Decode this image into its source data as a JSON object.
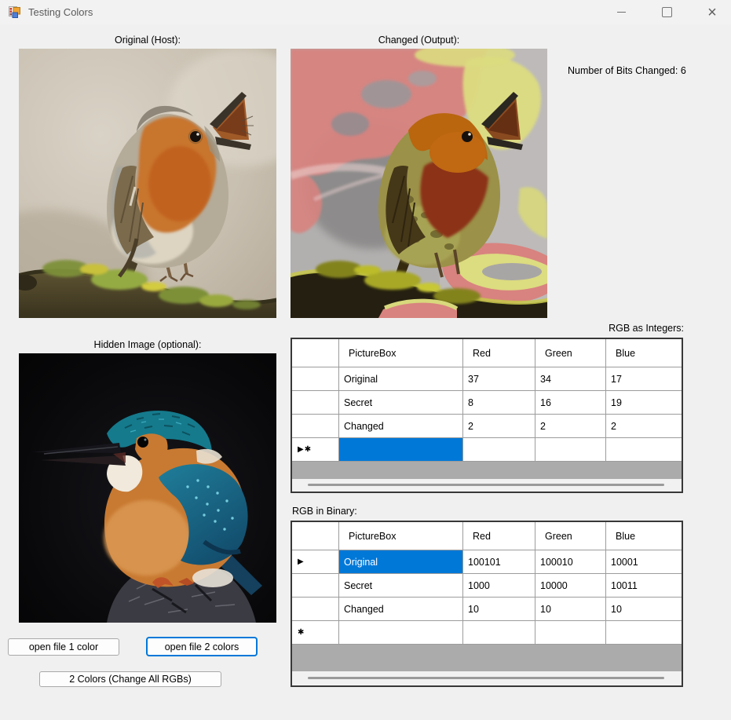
{
  "titlebar": {
    "title": "Testing Colors",
    "controls": {
      "minimize": "",
      "close": "×"
    }
  },
  "labels": {
    "original_caption": "Original (Host):",
    "changed_caption": "Changed (Output):",
    "bits_changed": "Number of Bits Changed: 6",
    "hidden_caption": "Hidden Image (optional):"
  },
  "tables": {
    "integers": {
      "title": "RGB as Integers:",
      "columns": [
        "PictureBox",
        "Red",
        "Green",
        "Blue"
      ],
      "rows": [
        [
          "Original",
          "37",
          "34",
          "17"
        ],
        [
          "Secret",
          "8",
          "16",
          "19"
        ],
        [
          "Changed",
          "2",
          "2",
          "2"
        ]
      ],
      "new_row_marker": "▶✱"
    },
    "binary": {
      "title": "RGB in Binary:",
      "columns": [
        "PictureBox",
        "Red",
        "Green",
        "Blue"
      ],
      "rows": [
        [
          "Original",
          "100101",
          "100010",
          "10001"
        ],
        [
          "Secret",
          "1000",
          "10000",
          "10011"
        ],
        [
          "Changed",
          "10",
          "10",
          "10"
        ]
      ],
      "selected_row_marker": "▶",
      "new_row_marker": "✱"
    }
  },
  "buttons": {
    "open_one": "open file 1 color",
    "open_two": "open file 2 colors",
    "change_all": "2 Colors (Change All RGBs)"
  },
  "colors": {
    "selection_blue": "#0078d8",
    "grid_filler_gray": "#ababab",
    "red_overlay": "#d8837f",
    "yellow_overlay": "#dcdc80",
    "window_bg": "#f0f0f0"
  }
}
